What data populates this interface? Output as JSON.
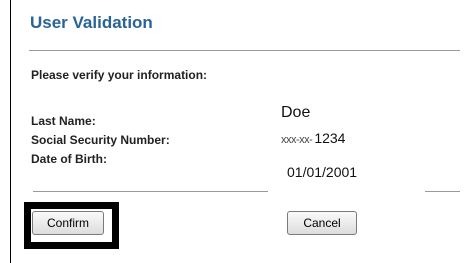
{
  "title": "User Validation",
  "instruction": "Please verify your information:",
  "fields": {
    "last_name": {
      "label": "Last Name:",
      "value": "Doe"
    },
    "ssn": {
      "label": "Social Security Number:",
      "mask": "xxx-xx-",
      "last4": "1234"
    },
    "dob": {
      "label": "Date of Birth:",
      "value": "01/01/2001"
    }
  },
  "buttons": {
    "confirm": "Confirm",
    "cancel": "Cancel"
  },
  "colors": {
    "title": "#2a6496",
    "highlight": "#000000"
  }
}
